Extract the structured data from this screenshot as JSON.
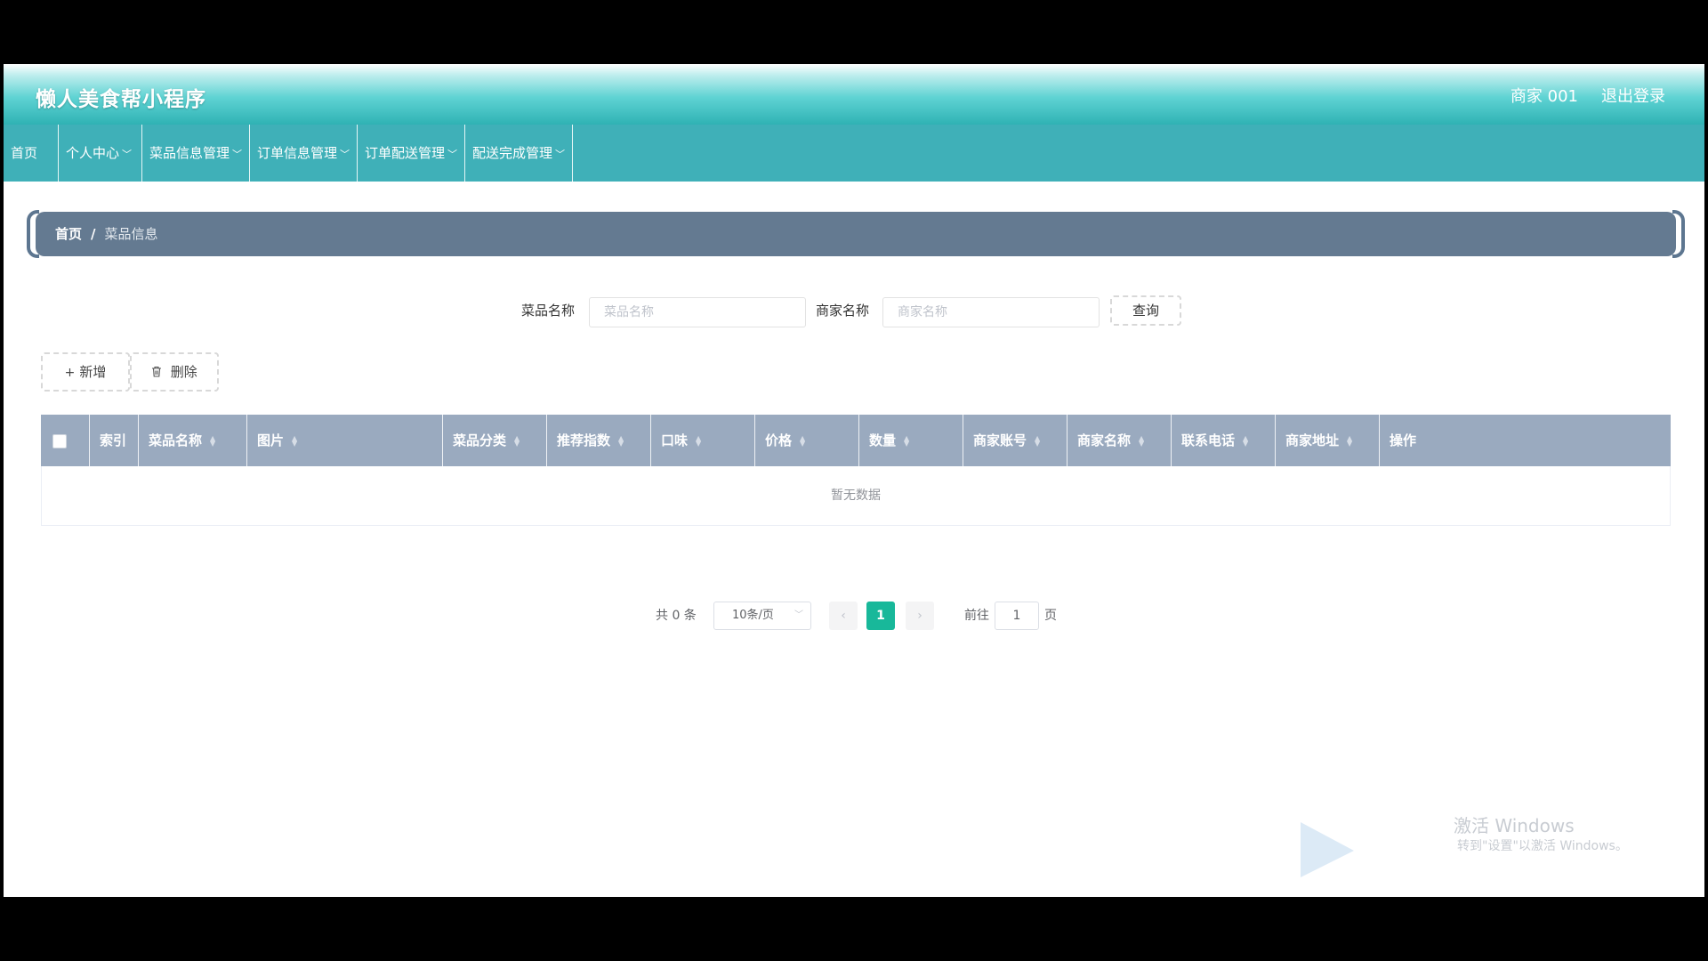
{
  "header": {
    "app_title": "懒人美食帮小程序",
    "user_name": "商家 001",
    "logout_label": "退出登录"
  },
  "nav": {
    "items": [
      {
        "label": "首页",
        "dropdown": false
      },
      {
        "label": "个人中心",
        "dropdown": true
      },
      {
        "label": "菜品信息管理",
        "dropdown": true
      },
      {
        "label": "订单信息管理",
        "dropdown": true
      },
      {
        "label": "订单配送管理",
        "dropdown": true
      },
      {
        "label": "配送完成管理",
        "dropdown": true
      }
    ]
  },
  "breadcrumb": {
    "home": "首页",
    "separator": "/",
    "current": "菜品信息"
  },
  "search": {
    "dish_label": "菜品名称",
    "dish_placeholder": "菜品名称",
    "dish_value": "",
    "merchant_label": "商家名称",
    "merchant_placeholder": "商家名称",
    "merchant_value": "",
    "query_label": "查询"
  },
  "actions": {
    "add_label": "新增",
    "delete_label": "删除"
  },
  "table": {
    "columns": [
      "索引",
      "菜品名称",
      "图片",
      "菜品分类",
      "推荐指数",
      "口味",
      "价格",
      "数量",
      "商家账号",
      "商家名称",
      "联系电话",
      "商家地址",
      "操作"
    ],
    "empty_text": "暂无数据",
    "rows": []
  },
  "pagination": {
    "total_text": "共 0 条",
    "page_size": "10条/页",
    "current_page": "1",
    "goto_label": "前往",
    "goto_value": "1",
    "page_suffix": "页"
  },
  "watermark": {
    "line1": "激活 Windows",
    "line2": "转到\"设置\"以激活 Windows。"
  },
  "colors": {
    "header_teal": "#3fb0b8",
    "breadcrumb_bg": "#647a91",
    "table_header": "#9aaabf",
    "page_active": "#18b89a"
  }
}
